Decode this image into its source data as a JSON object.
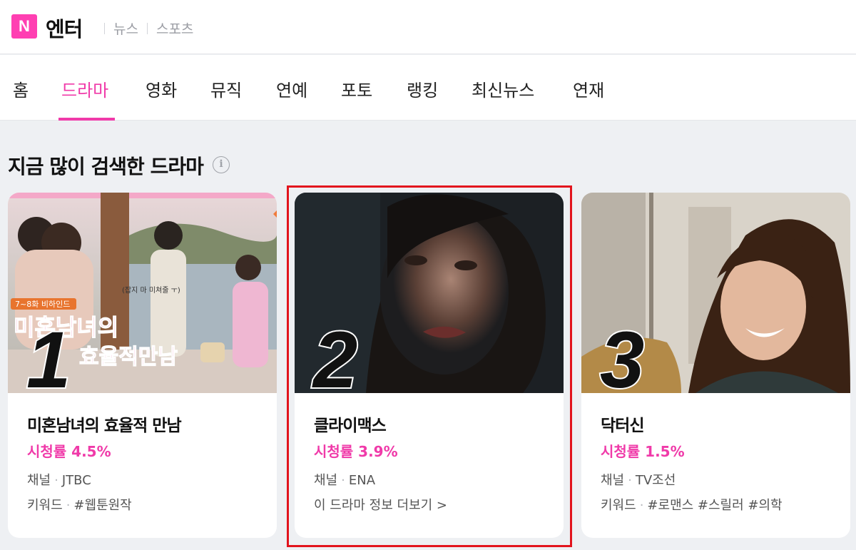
{
  "header": {
    "logo_letter": "N",
    "brand": "엔터",
    "links": [
      "뉴스",
      "스포츠"
    ]
  },
  "nav": {
    "tabs": [
      "홈",
      "드라마",
      "영화",
      "뮤직",
      "연예",
      "포토",
      "랭킹",
      "최신뉴스",
      "연재"
    ],
    "active": "드라마"
  },
  "section": {
    "title": "지금 많이 검색한 드라마",
    "info_icon": "i"
  },
  "cards": [
    {
      "rank": "1",
      "title": "미혼남녀의 효율적 만남",
      "rating": "시청률 4.5%",
      "channel_label": "채널",
      "channel": "JTBC",
      "keyword_label": "키워드",
      "keywords": "#웹툰원작",
      "image_badge": "7~8화 비하인드",
      "image_title_1": "미혼남녀의",
      "image_title_2": "효율적만남",
      "image_caption": "(잡지 마 미쳐줄 ㅜ)"
    },
    {
      "rank": "2",
      "title": "클라이맥스",
      "rating": "시청률 3.9%",
      "channel_label": "채널",
      "channel": "ENA",
      "more": "이 드라마 정보 더보기 >"
    },
    {
      "rank": "3",
      "title": "닥터신",
      "rating": "시청률 1.5%",
      "channel_label": "채널",
      "channel": "TV조선",
      "keyword_label": "키워드",
      "keywords": "#로맨스 #스릴러 #의학"
    }
  ],
  "colors": {
    "accent": "#f03aa9",
    "logo": "#ff3fb2",
    "highlight_box": "#e2141d",
    "background": "#eef0f3"
  }
}
